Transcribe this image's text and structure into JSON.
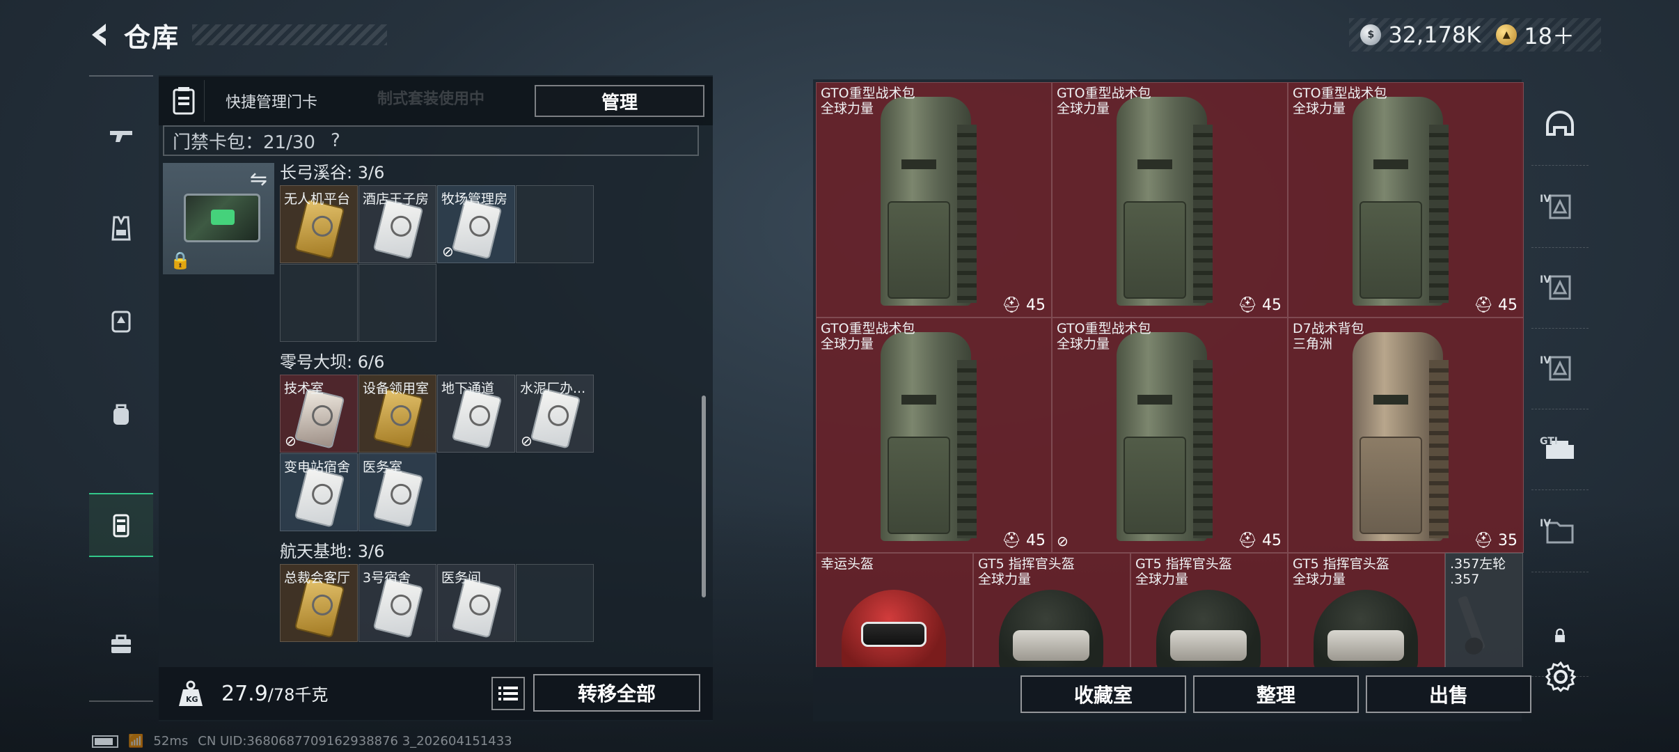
{
  "header": {
    "title": "仓库",
    "currency_silver": "32,178K",
    "currency_gold": "18＋"
  },
  "left_nav": {
    "items": [
      "weapon-icon",
      "armor-vest-icon",
      "chest-rig-icon",
      "backpack-icon",
      "keycard-icon",
      "toolbox-icon"
    ],
    "active_index": 4
  },
  "left_panel": {
    "quick_manage_title": "快捷管理门卡",
    "ghost_text": "制式套装使用中",
    "manage_button": "管理",
    "keycard_pack_label": "门禁卡包：21/30",
    "help_symbol": "?",
    "zones": [
      {
        "title": "长弓溪谷: 3/6",
        "slots": [
          {
            "label": "无人机平台",
            "style": "gold",
            "broken": false
          },
          {
            "label": "酒店王子房",
            "style": "grey",
            "broken": false
          },
          {
            "label": "牧场管理房",
            "style": "blue",
            "broken": true
          },
          {
            "label": "",
            "style": "empty",
            "broken": false
          },
          {
            "label": "",
            "style": "empty",
            "broken": false
          },
          {
            "label": "",
            "style": "empty",
            "broken": false
          }
        ]
      },
      {
        "title": "零号大坝: 6/6",
        "slots": [
          {
            "label": "技术室",
            "style": "red",
            "broken": true
          },
          {
            "label": "设备领用室",
            "style": "gold",
            "broken": false
          },
          {
            "label": "地下通道",
            "style": "grey",
            "broken": false
          },
          {
            "label": "水泥厂办...",
            "style": "grey",
            "broken": true
          },
          {
            "label": "变电站宿舍",
            "style": "blue",
            "broken": false
          },
          {
            "label": "医务室",
            "style": "blue",
            "broken": false
          }
        ]
      },
      {
        "title": "航天基地: 3/6",
        "slots": [
          {
            "label": "总裁会客厅",
            "style": "gold",
            "broken": false
          },
          {
            "label": "3号宿舍",
            "style": "grey",
            "broken": false
          },
          {
            "label": "医务间",
            "style": "grey",
            "broken": false
          },
          {
            "label": "",
            "style": "empty",
            "broken": false
          }
        ]
      }
    ],
    "weight_current": "27.9",
    "weight_max": "/78千克",
    "transfer_all_button": "转移全部"
  },
  "storage": {
    "items": [
      {
        "name": "GTO重型战术包",
        "sub": "全球力量",
        "count": "45",
        "kind": "bag",
        "broken": false
      },
      {
        "name": "GTO重型战术包",
        "sub": "全球力量",
        "count": "45",
        "kind": "bag",
        "broken": false
      },
      {
        "name": "GTO重型战术包",
        "sub": "全球力量",
        "count": "45",
        "kind": "bag",
        "broken": false
      },
      {
        "name": "GTO重型战术包",
        "sub": "全球力量",
        "count": "45",
        "kind": "bag",
        "broken": false
      },
      {
        "name": "GTO重型战术包",
        "sub": "全球力量",
        "count": "45",
        "kind": "bag",
        "broken": true
      },
      {
        "name": "D7战术背包",
        "sub": "三角洲",
        "count": "35",
        "kind": "bag-tan",
        "broken": false
      },
      {
        "name": "幸运头盔",
        "sub": "",
        "count": "",
        "kind": "helmet-red",
        "broken": false
      },
      {
        "name": "GT5 指挥官头盔",
        "sub": "全球力量",
        "count": "",
        "kind": "helmet",
        "broken": false
      },
      {
        "name": "GT5 指挥官头盔",
        "sub": "全球力量",
        "count": "",
        "kind": "helmet",
        "broken": false
      },
      {
        "name": "GT5 指挥官头盔",
        "sub": "全球力量",
        "count": "",
        "kind": "helmet",
        "broken": false
      },
      {
        "name": ".357左轮",
        "sub": ".357",
        "count": "",
        "kind": "revolver",
        "broken": false
      }
    ],
    "buttons": {
      "collection": "收藏室",
      "sort": "整理",
      "sell": "出售"
    }
  },
  "right_nav": {
    "items": [
      {
        "icon": "helmet-outline-icon",
        "tag": ""
      },
      {
        "icon": "storage-tier-icon",
        "tag": "IV"
      },
      {
        "icon": "storage-tier-icon",
        "tag": "IV"
      },
      {
        "icon": "storage-tier-icon",
        "tag": "IV"
      },
      {
        "icon": "gti-case-icon",
        "tag": "GTI"
      },
      {
        "icon": "folder-tier-icon",
        "tag": "IV"
      },
      {
        "icon": "lock-icon",
        "tag": ""
      }
    ]
  },
  "status_bar": {
    "ping": "52ms",
    "uid": "CN UID:3680687709162938876 3_202604151433"
  }
}
